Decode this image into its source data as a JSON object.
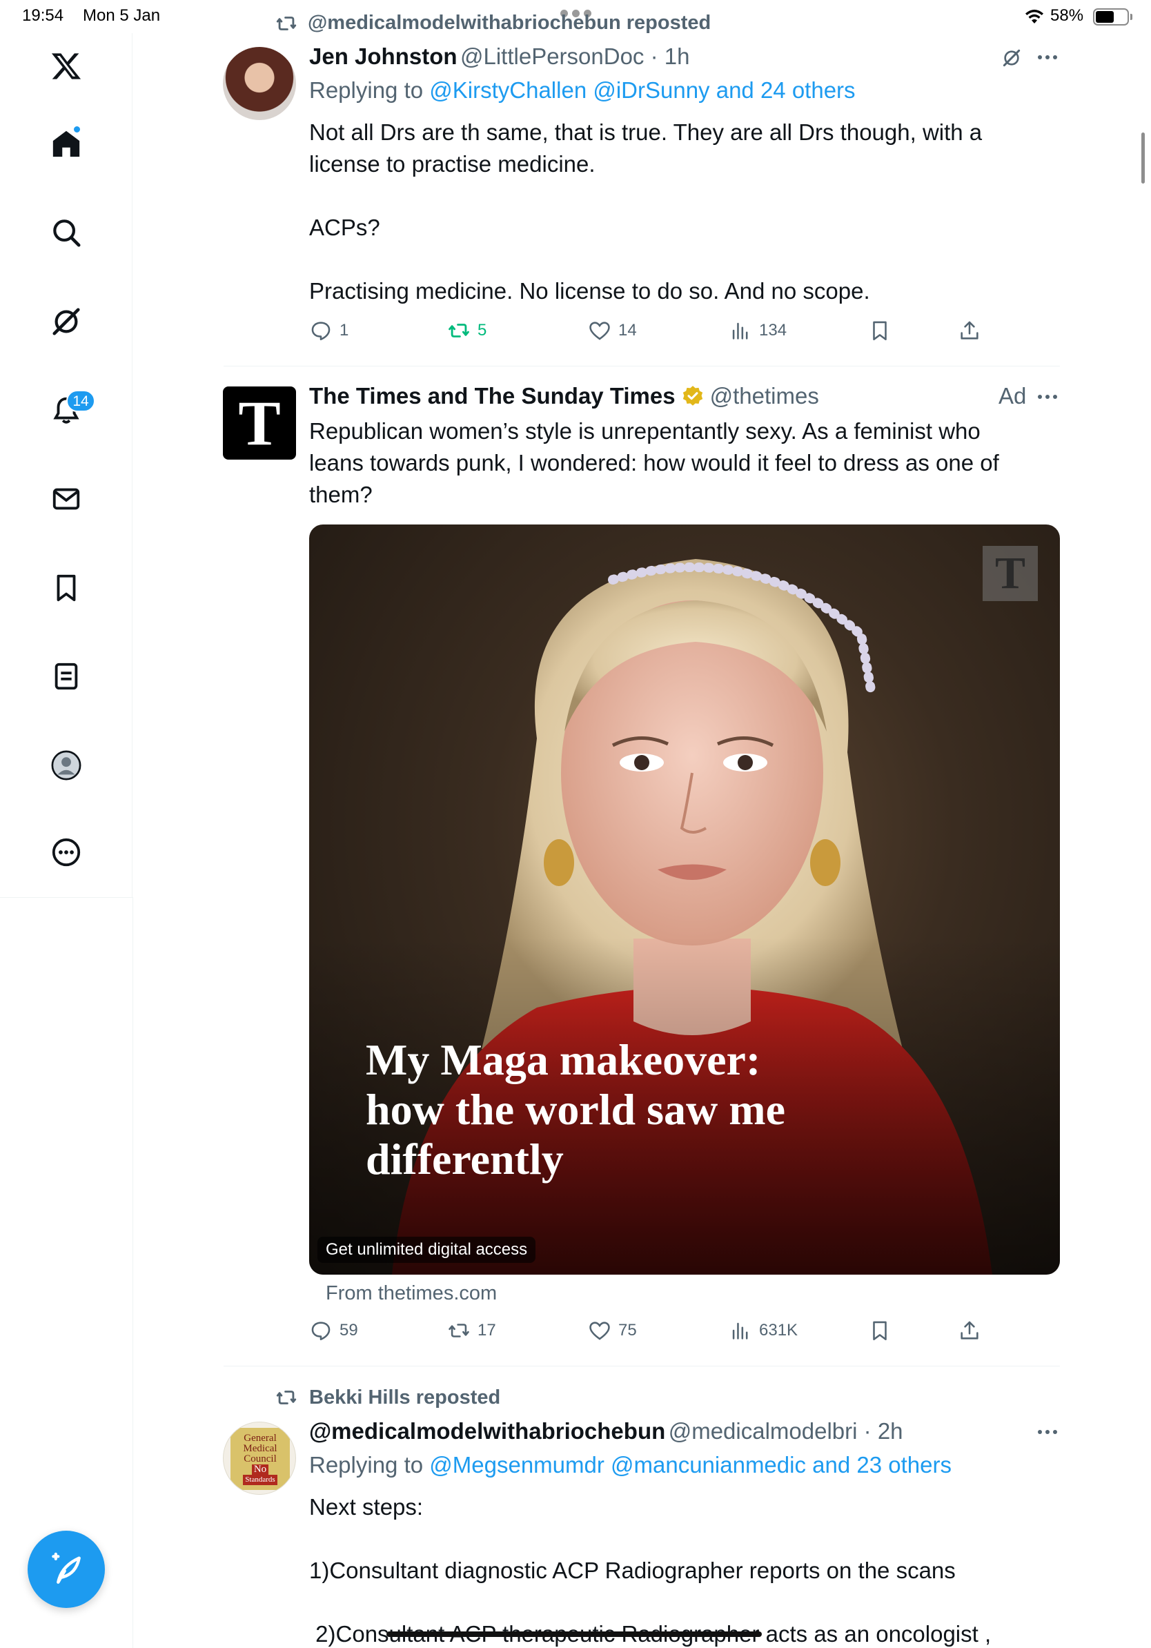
{
  "status_bar": {
    "time": "19:54",
    "date": "Mon 5 Jan",
    "battery_pct": "58%",
    "battery_level": 0.58
  },
  "sidebar": {
    "items": [
      {
        "icon": "x-logo-icon"
      },
      {
        "icon": "home-icon"
      },
      {
        "icon": "search-icon"
      },
      {
        "icon": "grok-icon"
      },
      {
        "icon": "bell-icon",
        "badge": "14"
      },
      {
        "icon": "mail-icon"
      },
      {
        "icon": "bookmark-icon"
      },
      {
        "icon": "lists-icon"
      },
      {
        "icon": "profile-icon"
      },
      {
        "icon": "more-circle-icon"
      }
    ],
    "compose_icon": "compose-feather-icon"
  },
  "colors": {
    "accent": "#1d9bf0",
    "repost_green": "#00ba7c",
    "muted": "#536471",
    "text": "#0f1419"
  },
  "tweets": [
    {
      "repost_label": "@medicalmodelwithabriochebun reposted",
      "name": "Jen Johnston",
      "handle": "@LittlePersonDoc",
      "time": "1h",
      "replying_prefix": "Replying to ",
      "replying_to": "@KirstyChallen @iDrSunny and 24 others",
      "body": "Not all Drs are th same, that is true. They are all Drs though, with a license to practise medicine.\n\nACPs?\n\nPractising medicine. No license to do so. And no scope.",
      "replies": "1",
      "reposts": "5",
      "likes": "14",
      "views": "134"
    },
    {
      "name": "The Times and The Sunday Times",
      "handle": "@thetimes",
      "ad_label": "Ad",
      "body": "Republican women’s style is unrepentantly sexy. As a feminist who leans towards punk, I wondered: how would it feel to dress as one of them?",
      "card_headline": "My Maga makeover: how the world saw me differently",
      "card_logo": "T",
      "card_cta": "Get unlimited digital access",
      "card_source": "From thetimes.com",
      "replies": "59",
      "reposts": "17",
      "likes": "75",
      "views": "631K"
    },
    {
      "repost_label": "Bekki Hills reposted",
      "name": "@medicalmodelwithabriochebun",
      "handle": "@medicalmodelbri",
      "time": "2h",
      "replying_prefix": "Replying to ",
      "replying_to": "@Megsenmumdr @mancunianmedic and 23 others",
      "body_line1": "Next steps:",
      "body_line2": "1)Consultant diagnostic ACP Radiographer reports on the scans",
      "body_line3": " 2)Consultant ACP therapeutic Radiographer acts as an oncologist ,",
      "avatar_text": [
        "General",
        "Medical",
        "Council",
        "No",
        "Standards"
      ]
    }
  ]
}
